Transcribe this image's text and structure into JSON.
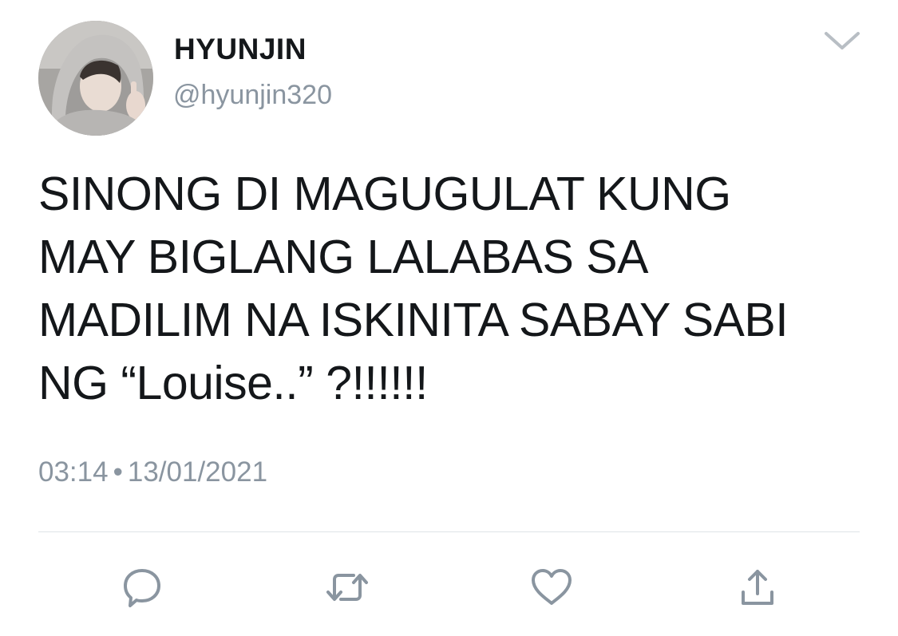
{
  "tweet": {
    "author": {
      "display_name": "HYUNJIN",
      "handle": "@hyunjin320",
      "avatar": "profile-photo"
    },
    "text": "SINONG DI MAGUGULAT KUNG\nMAY BIGLANG LALABAS SA\nMADILIM NA ISKINITA SABAY SABI\nNG “Louise..” ?!!!!!!",
    "time": "03:14",
    "separator": "•",
    "date": "13/01/2021"
  },
  "actions": [
    {
      "name": "reply",
      "icon": "reply-icon"
    },
    {
      "name": "retweet",
      "icon": "retweet-icon"
    },
    {
      "name": "like",
      "icon": "heart-icon"
    },
    {
      "name": "share",
      "icon": "share-icon"
    }
  ],
  "menu": {
    "icon": "chevron-down-icon"
  },
  "colors": {
    "text": "#14171a",
    "secondary": "#8a95a0",
    "icon": "#8a95a0",
    "divider": "#dfe3e7",
    "background": "#ffffff"
  }
}
